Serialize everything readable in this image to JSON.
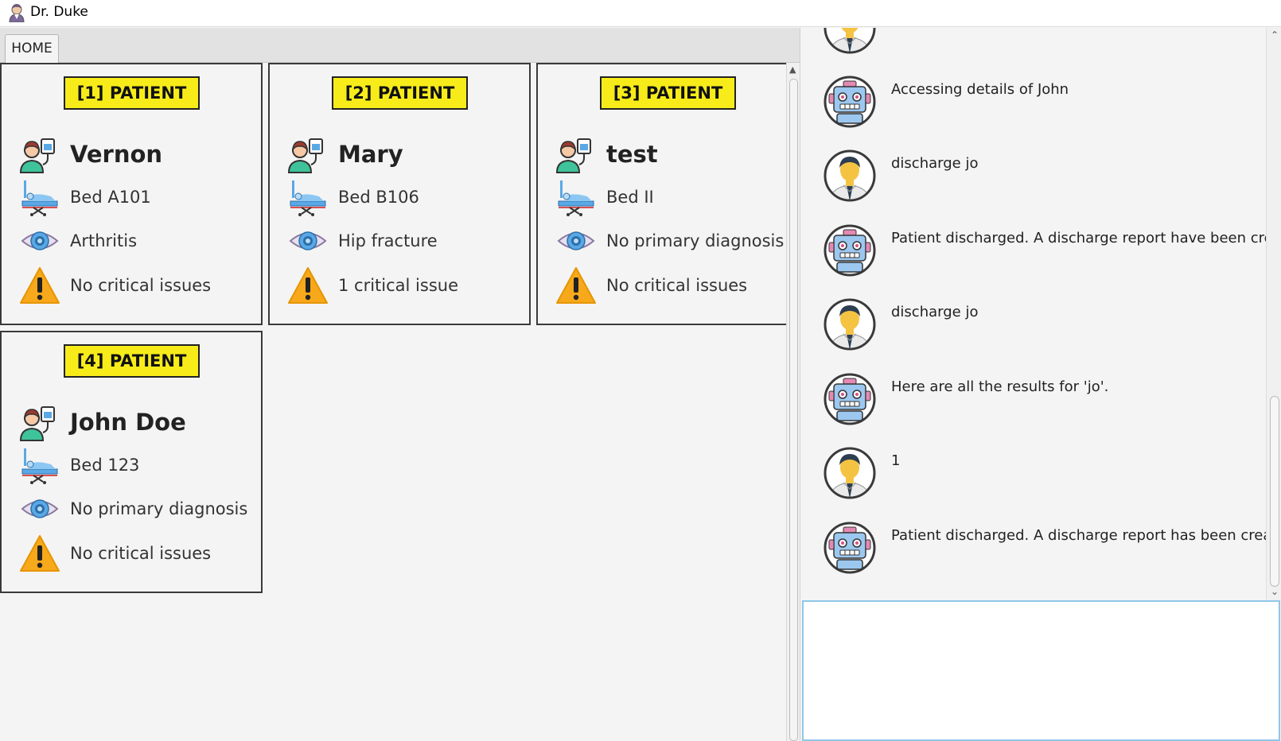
{
  "window": {
    "title": "Dr. Duke"
  },
  "tabs": [
    {
      "label": "HOME"
    }
  ],
  "patients": [
    {
      "header": "[1] PATIENT",
      "name": "Vernon",
      "bed": "Bed A101",
      "diagnosis": "Arthritis",
      "critical": "No critical issues"
    },
    {
      "header": "[2] PATIENT",
      "name": "Mary",
      "bed": "Bed B106",
      "diagnosis": "Hip fracture",
      "critical": "1 critical issue"
    },
    {
      "header": "[3] PATIENT",
      "name": "test",
      "bed": "Bed II",
      "diagnosis": "No primary diagnosis",
      "critical": "No critical issues"
    },
    {
      "header": "[4] PATIENT",
      "name": "John Doe",
      "bed": "Bed 123",
      "diagnosis": "No primary diagnosis",
      "critical": "No critical issues"
    }
  ],
  "chat": {
    "messages": [
      {
        "sender": "user",
        "text": ""
      },
      {
        "sender": "bot",
        "text": "Accessing details of John"
      },
      {
        "sender": "user",
        "text": "discharge jo"
      },
      {
        "sender": "bot",
        "text": "Patient discharged. A discharge report have been created."
      },
      {
        "sender": "user",
        "text": "discharge jo"
      },
      {
        "sender": "bot",
        "text": "Here are all the results for 'jo'."
      },
      {
        "sender": "user",
        "text": "1"
      },
      {
        "sender": "bot",
        "text": "Patient discharged. A discharge report has been created."
      }
    ],
    "input_value": ""
  },
  "colors": {
    "header_yellow": "#f7ec1a",
    "input_border": "#8fc7e8"
  }
}
